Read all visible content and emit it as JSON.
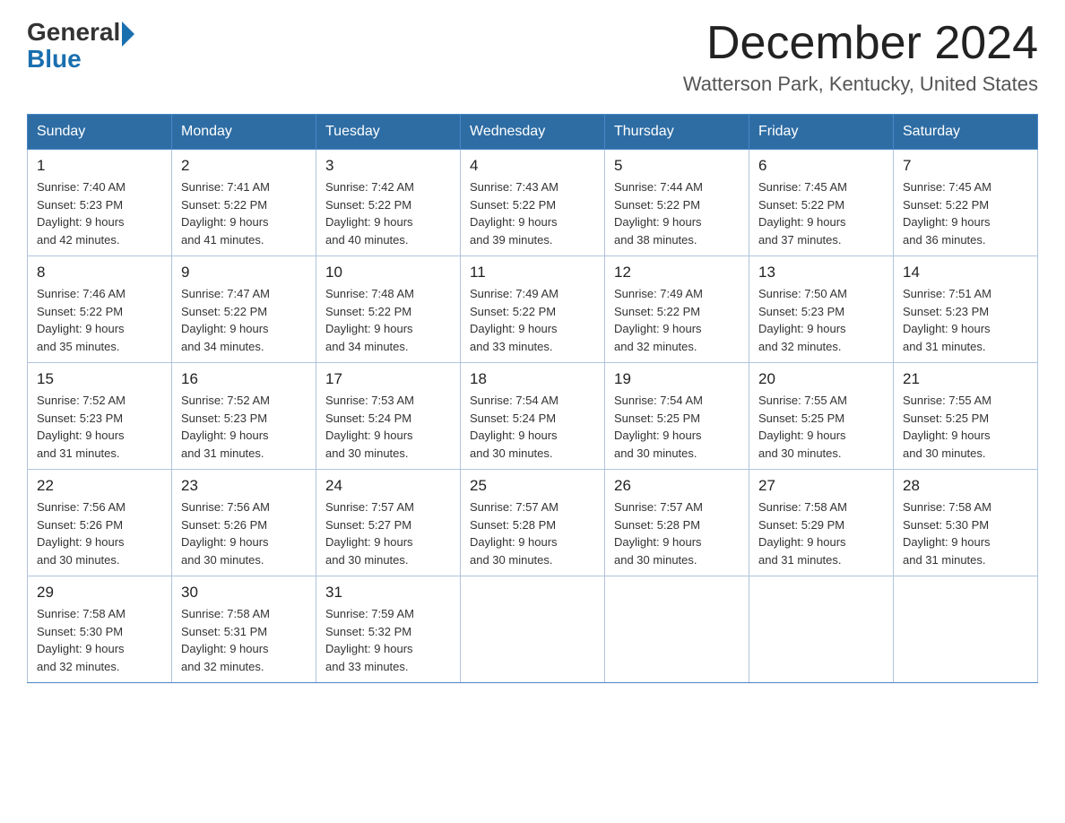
{
  "header": {
    "logo_general": "General",
    "logo_blue": "Blue",
    "month_title": "December 2024",
    "location": "Watterson Park, Kentucky, United States"
  },
  "days_of_week": [
    "Sunday",
    "Monday",
    "Tuesday",
    "Wednesday",
    "Thursday",
    "Friday",
    "Saturday"
  ],
  "weeks": [
    [
      {
        "day": "1",
        "sunrise": "7:40 AM",
        "sunset": "5:23 PM",
        "daylight": "9 hours and 42 minutes."
      },
      {
        "day": "2",
        "sunrise": "7:41 AM",
        "sunset": "5:22 PM",
        "daylight": "9 hours and 41 minutes."
      },
      {
        "day": "3",
        "sunrise": "7:42 AM",
        "sunset": "5:22 PM",
        "daylight": "9 hours and 40 minutes."
      },
      {
        "day": "4",
        "sunrise": "7:43 AM",
        "sunset": "5:22 PM",
        "daylight": "9 hours and 39 minutes."
      },
      {
        "day": "5",
        "sunrise": "7:44 AM",
        "sunset": "5:22 PM",
        "daylight": "9 hours and 38 minutes."
      },
      {
        "day": "6",
        "sunrise": "7:45 AM",
        "sunset": "5:22 PM",
        "daylight": "9 hours and 37 minutes."
      },
      {
        "day": "7",
        "sunrise": "7:45 AM",
        "sunset": "5:22 PM",
        "daylight": "9 hours and 36 minutes."
      }
    ],
    [
      {
        "day": "8",
        "sunrise": "7:46 AM",
        "sunset": "5:22 PM",
        "daylight": "9 hours and 35 minutes."
      },
      {
        "day": "9",
        "sunrise": "7:47 AM",
        "sunset": "5:22 PM",
        "daylight": "9 hours and 34 minutes."
      },
      {
        "day": "10",
        "sunrise": "7:48 AM",
        "sunset": "5:22 PM",
        "daylight": "9 hours and 34 minutes."
      },
      {
        "day": "11",
        "sunrise": "7:49 AM",
        "sunset": "5:22 PM",
        "daylight": "9 hours and 33 minutes."
      },
      {
        "day": "12",
        "sunrise": "7:49 AM",
        "sunset": "5:22 PM",
        "daylight": "9 hours and 32 minutes."
      },
      {
        "day": "13",
        "sunrise": "7:50 AM",
        "sunset": "5:23 PM",
        "daylight": "9 hours and 32 minutes."
      },
      {
        "day": "14",
        "sunrise": "7:51 AM",
        "sunset": "5:23 PM",
        "daylight": "9 hours and 31 minutes."
      }
    ],
    [
      {
        "day": "15",
        "sunrise": "7:52 AM",
        "sunset": "5:23 PM",
        "daylight": "9 hours and 31 minutes."
      },
      {
        "day": "16",
        "sunrise": "7:52 AM",
        "sunset": "5:23 PM",
        "daylight": "9 hours and 31 minutes."
      },
      {
        "day": "17",
        "sunrise": "7:53 AM",
        "sunset": "5:24 PM",
        "daylight": "9 hours and 30 minutes."
      },
      {
        "day": "18",
        "sunrise": "7:54 AM",
        "sunset": "5:24 PM",
        "daylight": "9 hours and 30 minutes."
      },
      {
        "day": "19",
        "sunrise": "7:54 AM",
        "sunset": "5:25 PM",
        "daylight": "9 hours and 30 minutes."
      },
      {
        "day": "20",
        "sunrise": "7:55 AM",
        "sunset": "5:25 PM",
        "daylight": "9 hours and 30 minutes."
      },
      {
        "day": "21",
        "sunrise": "7:55 AM",
        "sunset": "5:25 PM",
        "daylight": "9 hours and 30 minutes."
      }
    ],
    [
      {
        "day": "22",
        "sunrise": "7:56 AM",
        "sunset": "5:26 PM",
        "daylight": "9 hours and 30 minutes."
      },
      {
        "day": "23",
        "sunrise": "7:56 AM",
        "sunset": "5:26 PM",
        "daylight": "9 hours and 30 minutes."
      },
      {
        "day": "24",
        "sunrise": "7:57 AM",
        "sunset": "5:27 PM",
        "daylight": "9 hours and 30 minutes."
      },
      {
        "day": "25",
        "sunrise": "7:57 AM",
        "sunset": "5:28 PM",
        "daylight": "9 hours and 30 minutes."
      },
      {
        "day": "26",
        "sunrise": "7:57 AM",
        "sunset": "5:28 PM",
        "daylight": "9 hours and 30 minutes."
      },
      {
        "day": "27",
        "sunrise": "7:58 AM",
        "sunset": "5:29 PM",
        "daylight": "9 hours and 31 minutes."
      },
      {
        "day": "28",
        "sunrise": "7:58 AM",
        "sunset": "5:30 PM",
        "daylight": "9 hours and 31 minutes."
      }
    ],
    [
      {
        "day": "29",
        "sunrise": "7:58 AM",
        "sunset": "5:30 PM",
        "daylight": "9 hours and 32 minutes."
      },
      {
        "day": "30",
        "sunrise": "7:58 AM",
        "sunset": "5:31 PM",
        "daylight": "9 hours and 32 minutes."
      },
      {
        "day": "31",
        "sunrise": "7:59 AM",
        "sunset": "5:32 PM",
        "daylight": "9 hours and 33 minutes."
      },
      null,
      null,
      null,
      null
    ]
  ]
}
